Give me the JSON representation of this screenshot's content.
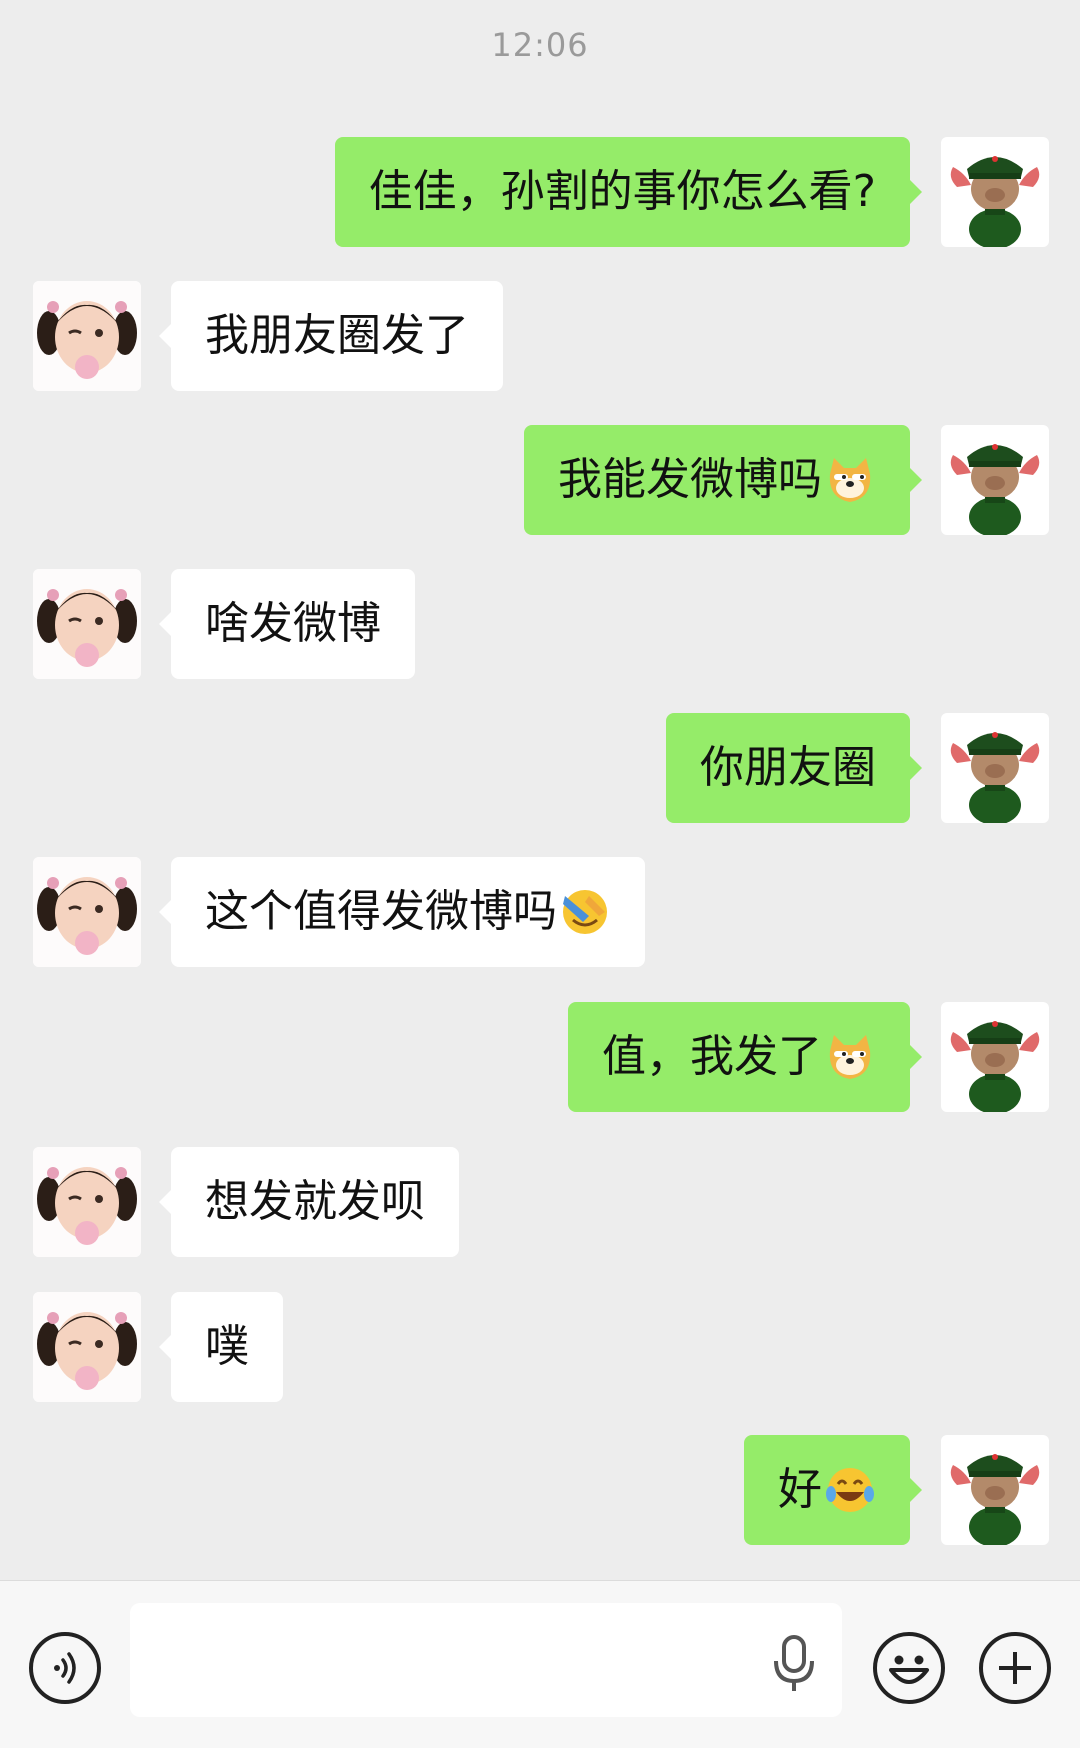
{
  "status": {
    "time": "12:06"
  },
  "colors": {
    "background": "#ededed",
    "sent_bubble": "#95ec69",
    "received_bubble": "#ffffff"
  },
  "messages": [
    {
      "from": "me",
      "text": "佳佳，孙割的事你怎么看?",
      "emoji": ""
    },
    {
      "from": "them",
      "text": "我朋友圈发了",
      "emoji": ""
    },
    {
      "from": "me",
      "text": "我能发微博吗",
      "emoji": "doge-icon"
    },
    {
      "from": "them",
      "text": "啥发微博",
      "emoji": ""
    },
    {
      "from": "me",
      "text": "你朋友圈",
      "emoji": ""
    },
    {
      "from": "them",
      "text": "这个值得发微博吗",
      "emoji": "facepalm-icon"
    },
    {
      "from": "me",
      "text": "值，我发了",
      "emoji": "doge-icon"
    },
    {
      "from": "them",
      "text": "想发就发呗",
      "emoji": ""
    },
    {
      "from": "them",
      "text": "噗",
      "emoji": ""
    },
    {
      "from": "me",
      "text": "好",
      "emoji": "tears-of-joy-icon"
    }
  ],
  "input_bar": {
    "voice_icon": "voice-icon",
    "mic_icon": "mic-icon",
    "emoji_icon": "smiley-icon",
    "plus_icon": "plus-icon",
    "input_value": ""
  }
}
